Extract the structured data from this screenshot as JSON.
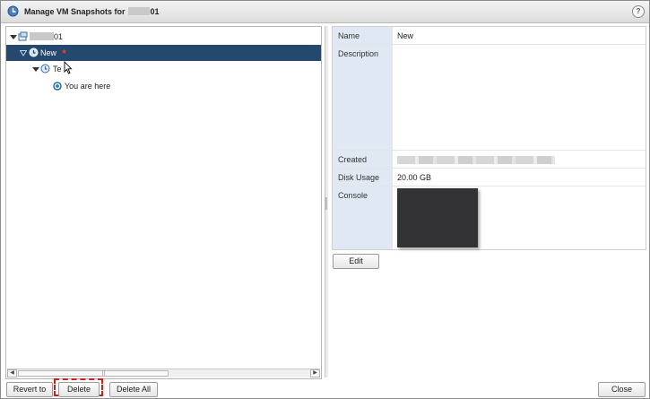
{
  "window": {
    "title_prefix": "Manage VM Snapshots for",
    "title_suffix": "01",
    "help_label": "?"
  },
  "tree": {
    "root_suffix": "01",
    "items": [
      {
        "label": "New",
        "selected": true,
        "starred": true
      },
      {
        "label": "Te",
        "selected": false
      },
      {
        "label": "You are here",
        "selected": false
      }
    ]
  },
  "details": {
    "name_label": "Name",
    "name_value": "New",
    "description_label": "Description",
    "description_value": "",
    "created_label": "Created",
    "disk_usage_label": "Disk Usage",
    "disk_usage_value": "20.00 GB",
    "console_label": "Console"
  },
  "buttons": {
    "edit": "Edit",
    "revert_to": "Revert to",
    "delete": "Delete",
    "delete_all": "Delete All",
    "close": "Close"
  },
  "scrollbar": {
    "left_arrow": "◀",
    "right_arrow": "▶",
    "grip": "⠿"
  },
  "colors": {
    "selection": "#24486e",
    "label_column": "#dfe8f3",
    "focus_ring": "#d21c1c",
    "console_thumbnail": "#333235"
  }
}
